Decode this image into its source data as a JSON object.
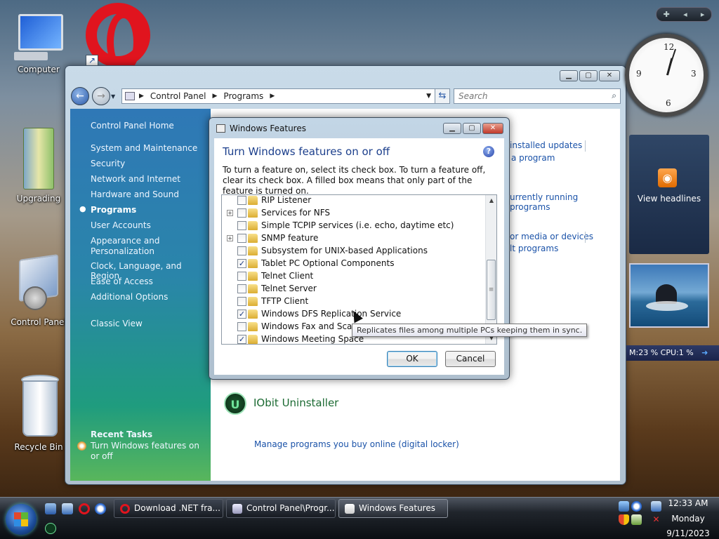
{
  "desktop": {
    "icons": [
      {
        "label": "Computer"
      },
      {
        "label": "Upgrading"
      },
      {
        "label": "Control Panel"
      },
      {
        "label": "Recycle Bin"
      }
    ]
  },
  "window": {
    "breadcrumb": [
      "Control Panel",
      "Programs"
    ],
    "search_placeholder": "Search",
    "sidebar": {
      "items": [
        {
          "label": "Control Panel Home"
        },
        {
          "label": "System and Maintenance"
        },
        {
          "label": "Security"
        },
        {
          "label": "Network and Internet"
        },
        {
          "label": "Hardware and Sound"
        },
        {
          "label": "Programs",
          "current": true
        },
        {
          "label": "User Accounts"
        },
        {
          "label": "Appearance and Personalization"
        },
        {
          "label": "Clock, Language, and Region"
        },
        {
          "label": "Ease of Access"
        },
        {
          "label": "Additional Options"
        },
        {
          "label": "Classic View"
        }
      ],
      "recent_tasks_header": "Recent Tasks",
      "recent_task": "Turn Windows features on or off"
    },
    "visible_links": [
      "installed updates",
      "a program",
      "urrently running programs",
      "or media or devices",
      "lt programs"
    ],
    "partial_link": "Manage programs you buy online (digital locker)",
    "iobit_label": "IObit Uninstaller"
  },
  "dialog": {
    "title": "Windows Features",
    "heading": "Turn Windows features on or off",
    "description": "To turn a feature on, select its check box. To turn a feature off, clear its check box. A filled box means that only part of the feature is turned on.",
    "features": [
      {
        "label": "RIP Listener",
        "checked": false,
        "expandable": false
      },
      {
        "label": "Services for NFS",
        "checked": false,
        "expandable": true
      },
      {
        "label": "Simple TCPIP services (i.e. echo, daytime etc)",
        "checked": false,
        "expandable": false
      },
      {
        "label": "SNMP feature",
        "checked": false,
        "expandable": true
      },
      {
        "label": "Subsystem for UNIX-based Applications",
        "checked": false,
        "expandable": false
      },
      {
        "label": "Tablet PC Optional Components",
        "checked": true,
        "expandable": false
      },
      {
        "label": "Telnet Client",
        "checked": false,
        "expandable": false
      },
      {
        "label": "Telnet Server",
        "checked": false,
        "expandable": false
      },
      {
        "label": "TFTP Client",
        "checked": false,
        "expandable": false
      },
      {
        "label": "Windows DFS Replication Service",
        "checked": true,
        "expandable": false
      },
      {
        "label": "Windows Fax and Scan",
        "checked": false,
        "expandable": false
      },
      {
        "label": "Windows Meeting Space",
        "checked": true,
        "expandable": false
      }
    ],
    "ok_label": "OK",
    "cancel_label": "Cancel",
    "tooltip": "Replicates files among multiple PCs keeping them in sync."
  },
  "gadgets": {
    "feed_label": "View headlines",
    "meter_text": "M:23 %   CPU:1 %"
  },
  "taskbar": {
    "tasks": [
      {
        "label": "Download .NET fra...",
        "active": false
      },
      {
        "label": "Control Panel\\Progr...",
        "active": false
      },
      {
        "label": "Windows Features",
        "active": true
      }
    ],
    "time": "12:33 AM",
    "day": "Monday",
    "date": "9/11/2023"
  },
  "colors": {
    "link": "#1a52a8",
    "heading": "#1c3f8c",
    "opera_red": "#e0141e",
    "iobit_green": "#1b6a32"
  }
}
